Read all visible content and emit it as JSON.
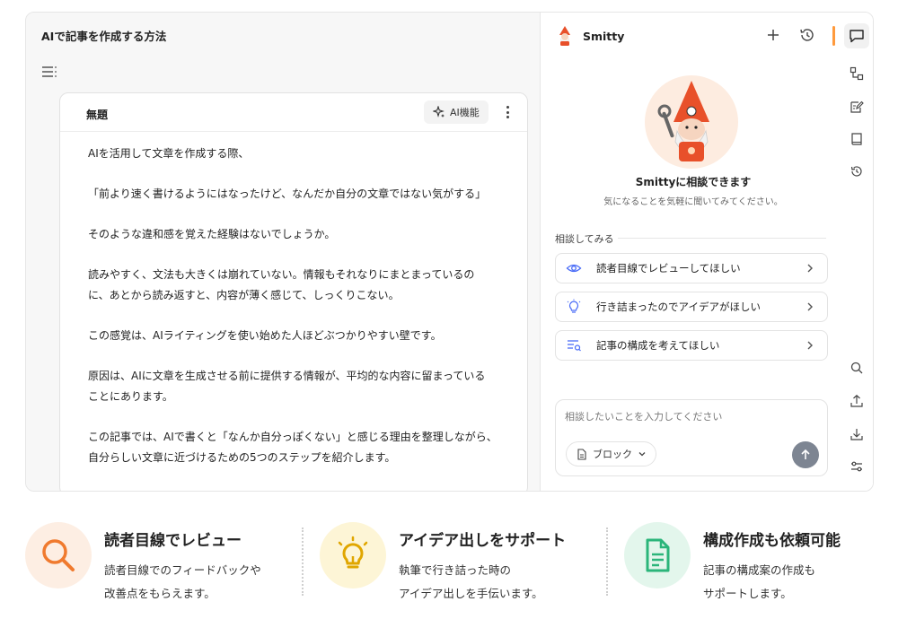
{
  "editor": {
    "title": "AIで記事を作成する方法",
    "card_title": "無題",
    "ai_button_label": "AI機能",
    "paragraphs": [
      "AIを活用して文章を作成する際、",
      "「前より速く書けるようにはなったけど、なんだか自分の文章ではない気がする」",
      "そのような違和感を覚えた経験はないでしょうか。",
      "読みやすく、文法も大きくは崩れていない。情報もそれなりにまとまっているの\nに、あとから読み返すと、内容が薄く感じて、しっくりこない。",
      "この感覚は、AIライティングを使い始めた人ほどぶつかりやすい壁です。",
      "原因は、AIに文章を生成させる前に提供する情報が、平均的な内容に留まっている\nことにあります。",
      "この記事では、AIで書くと「なんか自分っぽくない」と感じる理由を整理しながら、\n自分らしい文章に近づけるための5つのステップを紹介します。"
    ]
  },
  "assistant": {
    "name": "Smitty",
    "hero_title": "Smittyに相談できます",
    "hero_subtitle": "気になることを気軽に聞いてみてください。",
    "suggestions_label": "相談してみる",
    "suggestions": [
      {
        "label": "読者目線でレビューしてほしい",
        "icon": "eye-icon"
      },
      {
        "label": "行き詰まったのでアイデアがほしい",
        "icon": "lightbulb-icon"
      },
      {
        "label": "記事の構成を考えてほしい",
        "icon": "outline-icon"
      }
    ],
    "input_placeholder": "相談したいことを入力してください",
    "block_selector_label": "ブロック",
    "accent_color": "#ff9a3c"
  },
  "features": [
    {
      "title": "読者目線でレビュー",
      "desc": "読者目線でのフィードバックや\n改善点をもらえます。",
      "icon": "search-icon",
      "color": "#f07a2e",
      "bg": "#fdeee3"
    },
    {
      "title": "アイデア出しをサポート",
      "desc": "執筆で行き詰った時の\nアイデア出しを手伝います。",
      "icon": "lightbulb-icon",
      "color": "#e0a600",
      "bg": "#fdf5d6"
    },
    {
      "title": "構成作成も依頼可能",
      "desc": "記事の構成案の作成も\nサポートします。",
      "icon": "document-icon",
      "color": "#2bb57a",
      "bg": "#e3f6ec"
    }
  ]
}
